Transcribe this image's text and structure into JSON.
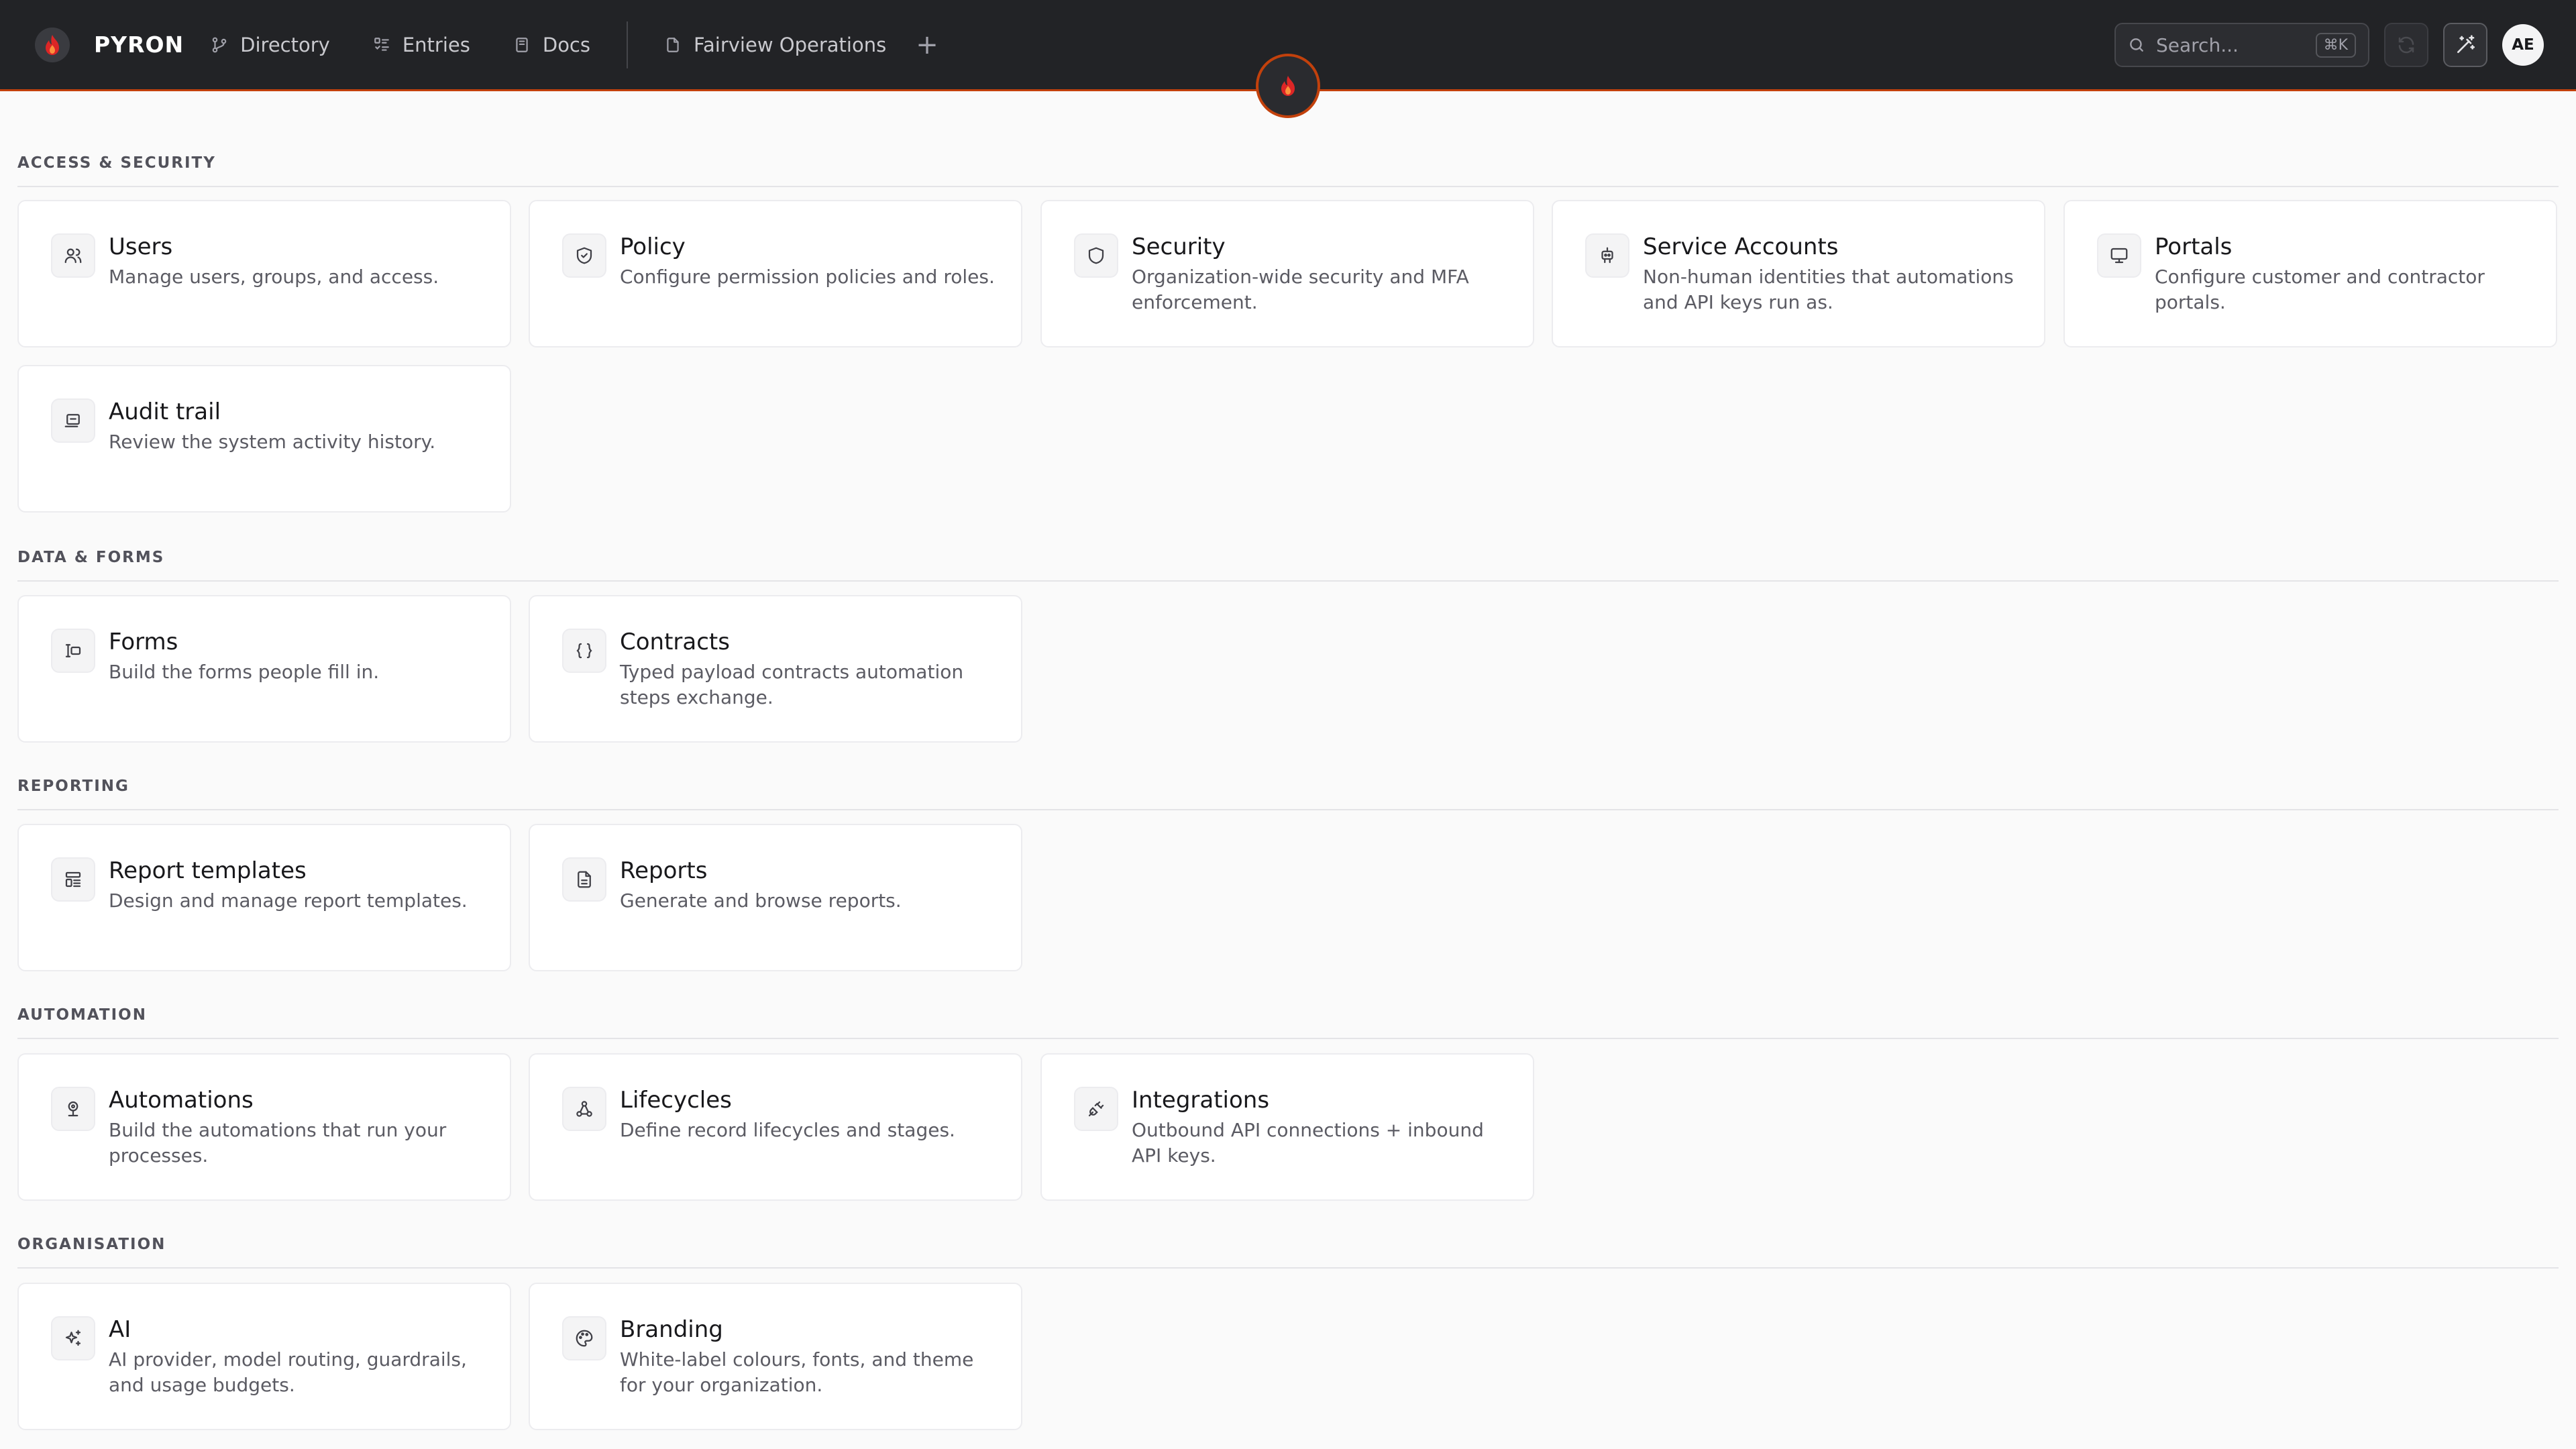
{
  "brand": {
    "name": "PYRON"
  },
  "nav": {
    "items": [
      {
        "label": "Directory",
        "icon": "directory-icon"
      },
      {
        "label": "Entries",
        "icon": "list-icon"
      },
      {
        "label": "Docs",
        "icon": "book-icon"
      }
    ],
    "workspace_tab": {
      "label": "Fairview Operations",
      "icon": "document-icon"
    },
    "add_icon": "plus-icon"
  },
  "search": {
    "placeholder": "Search...",
    "shortcut": "⌘K"
  },
  "user": {
    "initials": "AE"
  },
  "colors": {
    "accent": "#c2410c",
    "topbar": "#222326",
    "background": "#fafafa"
  },
  "sections": [
    {
      "title": "ACCESS & SECURITY",
      "cards": [
        {
          "title": "Users",
          "description": "Manage users, groups, and access.",
          "icon": "users-icon"
        },
        {
          "title": "Policy",
          "description": "Configure permission policies and roles.",
          "icon": "shield-check-icon"
        },
        {
          "title": "Security",
          "description": "Organization-wide security and MFA enforcement.",
          "icon": "shield-icon"
        },
        {
          "title": "Service Accounts",
          "description": "Non-human identities that automations and API keys run as.",
          "icon": "bot-icon"
        },
        {
          "title": "Portals",
          "description": "Configure customer and contractor portals.",
          "icon": "monitor-icon"
        },
        {
          "title": "Audit trail",
          "description": "Review the system activity history.",
          "icon": "scroll-icon"
        }
      ]
    },
    {
      "title": "DATA & FORMS",
      "cards": [
        {
          "title": "Forms",
          "description": "Build the forms people fill in.",
          "icon": "form-icon"
        },
        {
          "title": "Contracts",
          "description": "Typed payload contracts automation steps exchange.",
          "icon": "braces-icon"
        }
      ]
    },
    {
      "title": "REPORTING",
      "cards": [
        {
          "title": "Report templates",
          "description": "Design and manage report templates.",
          "icon": "template-icon"
        },
        {
          "title": "Reports",
          "description": "Generate and browse reports.",
          "icon": "file-text-icon"
        }
      ]
    },
    {
      "title": "AUTOMATION",
      "cards": [
        {
          "title": "Automations",
          "description": "Build the automations that run your processes.",
          "icon": "automation-icon"
        },
        {
          "title": "Lifecycles",
          "description": "Define record lifecycles and stages.",
          "icon": "workflow-icon"
        },
        {
          "title": "Integrations",
          "description": "Outbound API connections + inbound API keys.",
          "icon": "plug-icon"
        }
      ]
    },
    {
      "title": "ORGANISATION",
      "cards": [
        {
          "title": "AI",
          "description": "AI provider, model routing, guardrails, and usage budgets.",
          "icon": "sparkles-icon"
        },
        {
          "title": "Branding",
          "description": "White-label colours, fonts, and theme for your organization.",
          "icon": "palette-icon"
        }
      ]
    }
  ]
}
